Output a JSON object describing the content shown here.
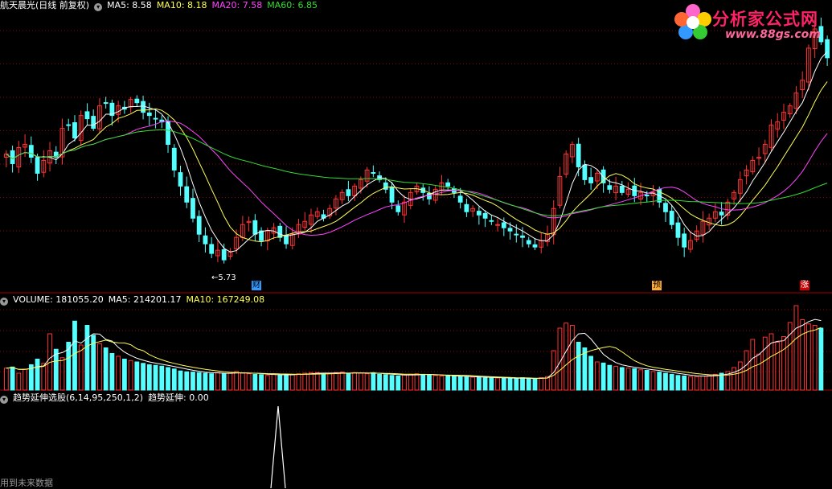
{
  "header": {
    "title": "航天晨光(日线 前复权)",
    "ma": [
      {
        "label": "MA5: 8.58",
        "color": "#ffffff"
      },
      {
        "label": "MA10: 8.18",
        "color": "#ffff55"
      },
      {
        "label": "MA20: 7.58",
        "color": "#ff44ff"
      },
      {
        "label": "MA60: 6.85",
        "color": "#33dd33"
      }
    ]
  },
  "volume_header": {
    "label": "VOLUME: 181055.20",
    "ma5": "MA5: 214201.17",
    "ma10": "MA10: 167249.08",
    "colors": {
      "label": "#ffffff",
      "ma5": "#ffffff",
      "ma10": "#ffff55"
    }
  },
  "indicator_header": {
    "name": "趋势延伸选股(6,14,95,250,1,2)",
    "value": "趋势延伸: 0.00"
  },
  "annotations": {
    "low_label": "←5.73",
    "badge_cai": "财",
    "badge_yu": "预",
    "badge_zhang": "涨"
  },
  "logo": {
    "title": "分析家公式网",
    "url": "www.88gs.com"
  },
  "footer": "用到未来数据",
  "colors": {
    "up": "#ff3333",
    "down": "#55ffff",
    "grid": "#8b0000",
    "ma5": "#ffffff",
    "ma10": "#ffff55",
    "ma20": "#ff44ff",
    "ma60": "#33dd33"
  },
  "chart_data": {
    "type": "candlestick",
    "price_range": [
      5.4,
      9.6
    ],
    "low_marker": 5.73,
    "closes": [
      7.45,
      7.3,
      7.55,
      7.6,
      7.4,
      7.15,
      7.35,
      7.5,
      7.4,
      7.85,
      7.9,
      7.7,
      8.05,
      8.0,
      7.85,
      8.2,
      8.25,
      8.05,
      8.2,
      8.15,
      8.3,
      8.25,
      8.1,
      8.05,
      8.0,
      7.95,
      7.6,
      7.2,
      6.95,
      6.7,
      6.45,
      6.2,
      6.05,
      5.9,
      5.95,
      5.8,
      5.92,
      6.15,
      6.35,
      6.4,
      6.2,
      6.1,
      6.25,
      6.3,
      6.15,
      6.05,
      6.2,
      6.35,
      6.4,
      6.5,
      6.55,
      6.45,
      6.6,
      6.75,
      6.85,
      6.8,
      6.95,
      7.05,
      7.2,
      7.15,
      7.05,
      6.9,
      6.7,
      6.55,
      6.7,
      6.85,
      6.95,
      6.85,
      6.75,
      6.9,
      7.0,
      6.95,
      6.85,
      6.7,
      6.55,
      6.6,
      6.5,
      6.45,
      6.4,
      6.35,
      6.3,
      6.25,
      6.2,
      6.15,
      6.05,
      6.0,
      6.1,
      6.2,
      6.6,
      7.1,
      7.45,
      7.6,
      7.25,
      7.05,
      7.0,
      7.15,
      7.0,
      6.9,
      6.95,
      6.85,
      6.9,
      6.8,
      6.85,
      6.8,
      6.85,
      6.7,
      6.55,
      6.35,
      6.15,
      6.0,
      6.1,
      6.25,
      6.4,
      6.45,
      6.55,
      6.5,
      6.7,
      6.85,
      7.05,
      7.2,
      7.35,
      7.4,
      7.6,
      7.9,
      7.95,
      8.1,
      8.2,
      8.4,
      8.6,
      9.1,
      9.4,
      9.2,
      8.95
    ],
    "volumes": [
      78,
      82,
      60,
      74,
      90,
      110,
      95,
      200,
      145,
      115,
      170,
      245,
      160,
      230,
      195,
      165,
      150,
      130,
      120,
      110,
      105,
      100,
      95,
      90,
      88,
      85,
      80,
      75,
      68,
      65,
      64,
      62,
      60,
      58,
      62,
      58,
      60,
      66,
      60,
      58,
      56,
      55,
      52,
      56,
      54,
      54,
      56,
      58,
      60,
      62,
      62,
      60,
      58,
      62,
      64,
      58,
      62,
      60,
      58,
      62,
      56,
      55,
      52,
      50,
      54,
      56,
      58,
      56,
      54,
      52,
      50,
      50,
      49,
      48,
      47,
      46,
      45,
      44,
      44,
      43,
      42,
      42,
      40,
      44,
      40,
      40,
      44,
      48,
      140,
      220,
      238,
      230,
      170,
      150,
      120,
      100,
      96,
      88,
      84,
      80,
      78,
      76,
      72,
      70,
      66,
      64,
      60,
      56,
      52,
      50,
      48,
      48,
      50,
      52,
      56,
      60,
      66,
      80,
      100,
      140,
      180,
      128,
      188,
      200,
      170,
      190,
      240,
      300,
      250,
      235,
      230,
      220
    ]
  }
}
